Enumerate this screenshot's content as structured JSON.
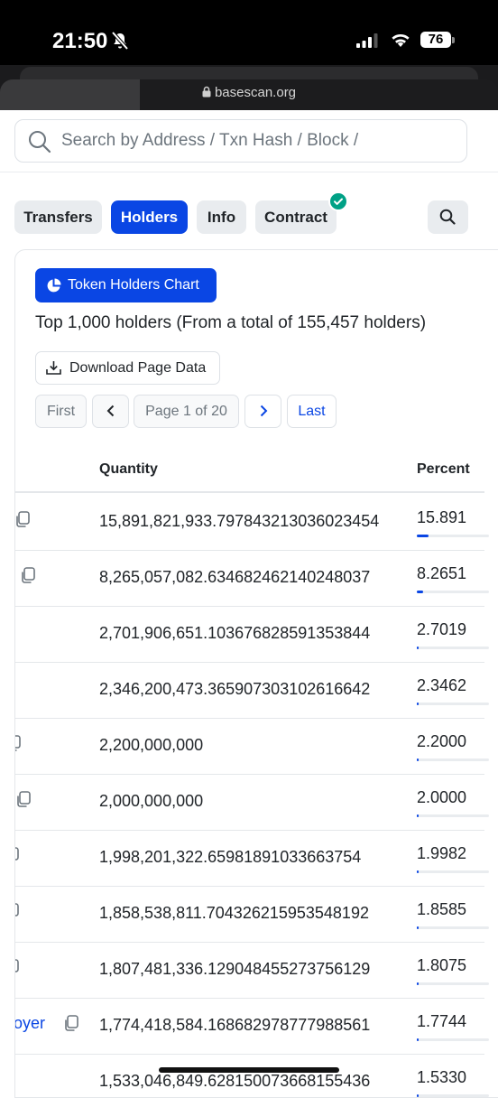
{
  "status_bar": {
    "time": "21:50",
    "battery": "76"
  },
  "browser": {
    "url": "basescan.org"
  },
  "search": {
    "placeholder": "Search by Address / Txn Hash / Block /"
  },
  "tabs": [
    {
      "label": "Transfers",
      "active": false
    },
    {
      "label": "Holders",
      "active": true
    },
    {
      "label": "Info",
      "active": false
    },
    {
      "label": "Contract",
      "active": false,
      "verified": true
    }
  ],
  "holders": {
    "chart_button": "Token Holders Chart",
    "summary": "Top 1,000 holders (From a total of 155,457 holders)",
    "download_button": "Download Page Data",
    "pagination": {
      "first": "First",
      "page": "Page 1 of 20",
      "last": "Last"
    },
    "columns": {
      "quantity": "Quantity",
      "percentage": "Percent"
    },
    "rows": [
      {
        "quantity": "15,891,821,933.797843213036023454",
        "percentage": "15.891",
        "share": 0.1589,
        "copy": true,
        "label": ""
      },
      {
        "quantity": "8,265,057,082.634682462140248037",
        "percentage": "8.2651",
        "share": 0.0827,
        "copy": true,
        "label": ""
      },
      {
        "quantity": "2,701,906,651.103676828591353844",
        "percentage": "2.7019",
        "share": 0.027,
        "copy": false,
        "label": ""
      },
      {
        "quantity": "2,346,200,473.365907303102616642",
        "percentage": "2.3462",
        "share": 0.0235,
        "copy": false,
        "label": ""
      },
      {
        "quantity": "2,200,000,000",
        "percentage": "2.2000",
        "share": 0.022,
        "copy": true,
        "label": ""
      },
      {
        "quantity": "2,000,000,000",
        "percentage": "2.0000",
        "share": 0.02,
        "copy": true,
        "label": ""
      },
      {
        "quantity": "1,998,201,322.65981891033663754",
        "percentage": "1.9982",
        "share": 0.02,
        "copy": true,
        "label": ""
      },
      {
        "quantity": "1,858,538,811.704326215953548192",
        "percentage": "1.8585",
        "share": 0.0186,
        "copy": true,
        "label": ""
      },
      {
        "quantity": "1,807,481,336.129048455273756129",
        "percentage": "1.8075",
        "share": 0.0181,
        "copy": true,
        "label": ""
      },
      {
        "quantity": "1,774,418,584.168682978777988561",
        "percentage": "1.7744",
        "share": 0.0177,
        "copy": true,
        "label": "loyer"
      },
      {
        "quantity": "1,533,046,849.628150073668155436",
        "percentage": "1.5330",
        "share": 0.0153,
        "copy": false,
        "label": ""
      }
    ]
  },
  "colors": {
    "primary": "#0a46e4",
    "verified": "#00a186"
  },
  "icons": [
    "bell-slash-icon",
    "signal-icon",
    "wifi-icon",
    "lock-icon",
    "search-icon",
    "check-icon",
    "pie-chart-icon",
    "download-icon",
    "chevron-left-icon",
    "chevron-right-icon",
    "copy-icon"
  ]
}
